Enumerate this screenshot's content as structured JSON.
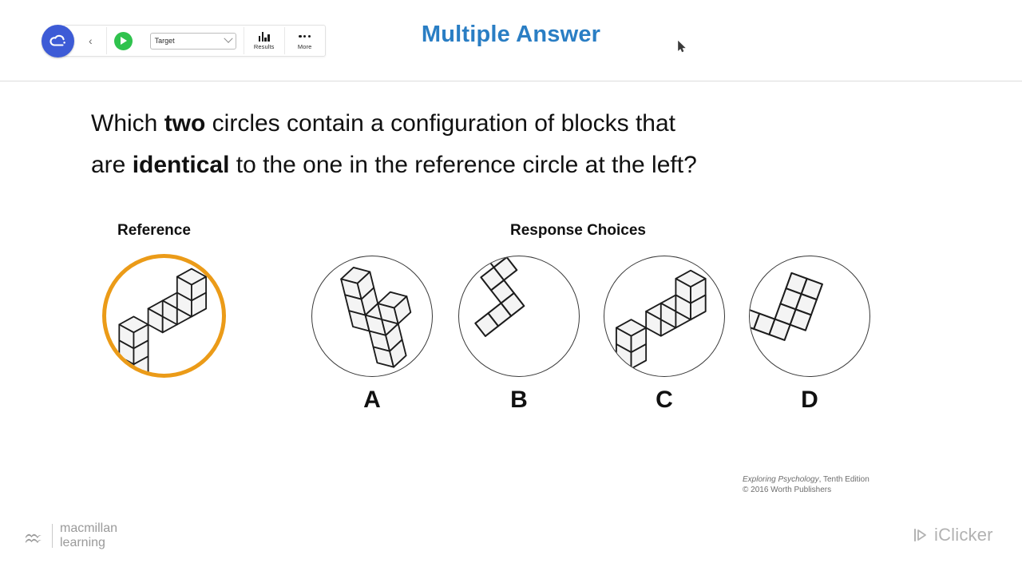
{
  "toolbar": {
    "cloud_icon": "cloud-icon",
    "collapse_chevron": "‹",
    "play_icon": "play-icon",
    "target_dropdown": {
      "value": "Target",
      "chevron_icon": "chevron-down-icon"
    },
    "results": {
      "label": "Results",
      "icon": "bar-chart-icon"
    },
    "more": {
      "label": "More",
      "icon": "ellipsis-icon"
    }
  },
  "header": {
    "title": "Multiple Answer"
  },
  "question": {
    "line1_pre": "Which ",
    "line1_bold": "two",
    "line1_post": " circles contain a configuration of blocks that",
    "line2_pre": "are ",
    "line2_bold": "identical",
    "line2_post": " to the one in the reference circle at the left?"
  },
  "stimulus": {
    "reference_label": "Reference",
    "choices_label": "Response Choices",
    "reference": {
      "name": "reference-circle",
      "ring_color": "#eb9b18"
    },
    "choices": [
      {
        "letter": "A",
        "name": "choice-circle-a"
      },
      {
        "letter": "B",
        "name": "choice-circle-b"
      },
      {
        "letter": "C",
        "name": "choice-circle-c"
      },
      {
        "letter": "D",
        "name": "choice-circle-d"
      }
    ]
  },
  "attribution": {
    "title": "Exploring Psychology",
    "edition": ", Tenth Edition",
    "copyright": "© 2016 Worth Publishers"
  },
  "footer": {
    "macmillan_line1": "macmillan",
    "macmillan_line2": "learning",
    "iclicker_label": "iClicker",
    "iclicker_icon": "play-triangle-icon"
  },
  "colors": {
    "title_blue": "#2a7ec4",
    "reference_ring": "#eb9b18",
    "play_green": "#2fc24d",
    "cloud_blue": "#3d5bd6",
    "circle_stroke": "#3a3a3a"
  }
}
